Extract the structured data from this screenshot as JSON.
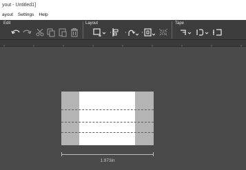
{
  "window": {
    "title": "yout - Untitled1]"
  },
  "menu": {
    "items": [
      "Layout",
      "Settings",
      "Help"
    ],
    "layout_visible": "ayout"
  },
  "ribbon": {
    "groups": [
      {
        "label": "Edit"
      },
      {
        "label": "Layout"
      },
      {
        "label": "Tape"
      }
    ],
    "tools": {
      "undo": "undo-icon",
      "redo": "redo-icon",
      "cut": "cut-icon",
      "copy": "copy-icon",
      "paste": "paste-icon",
      "delete": "trash-icon",
      "label_size": "label-size-icon",
      "align": "align-icon",
      "rotate": "rotate-icon",
      "fit": "fit-icon",
      "grid": "grid-icon",
      "tape_length": "tape-length-icon",
      "tape_margin": "tape-margin-icon",
      "tape_cut": "tape-cut-icon"
    }
  },
  "ruler": {
    "numbers": []
  },
  "label": {
    "length_text": "1.973in",
    "print_area_fraction": 0.6,
    "guide_count": 3
  },
  "colors": {
    "background": "#4a4a4a",
    "ribbon": "#3d3d3d",
    "label_margin": "#b4b4b4",
    "print_area": "#ffffff"
  }
}
